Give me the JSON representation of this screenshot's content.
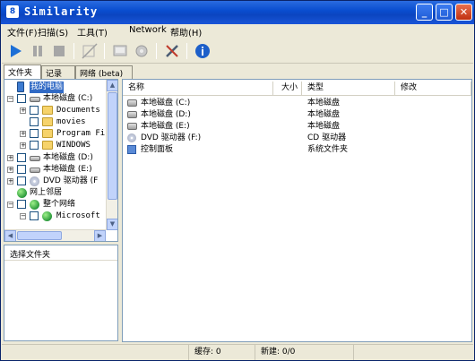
{
  "app": {
    "title": "Similarity",
    "icon_glyph": "8"
  },
  "window_controls": {
    "minimize": "_",
    "maximize": "□",
    "close": "✕"
  },
  "menu": [
    {
      "label": "文件(F)"
    },
    {
      "label": "扫描(S)"
    },
    {
      "label": "工具(T)"
    },
    {
      "label": "Network"
    },
    {
      "label": "帮助(H)"
    }
  ],
  "toolbar": {
    "play": "play-icon",
    "pause": "pause-icon",
    "stop": "stop-icon",
    "clear": "clear-icon",
    "export": "export-icon",
    "gear": "gear-icon",
    "tools": "wrench-icon",
    "info": "info-icon"
  },
  "tabs": [
    {
      "label": "文件夹"
    },
    {
      "label": "记录"
    },
    {
      "label": "网络 (beta)"
    }
  ],
  "tree": [
    {
      "label": "我的电脑",
      "icon": "computer-icon",
      "selected": true
    },
    {
      "label": "本地磁盘 (C:)",
      "icon": "drive-icon"
    },
    {
      "label": "Documents",
      "icon": "folder-icon"
    },
    {
      "label": "movies",
      "icon": "folder-icon"
    },
    {
      "label": "Program Fi",
      "icon": "folder-icon"
    },
    {
      "label": "WINDOWS",
      "icon": "folder-icon"
    },
    {
      "label": "本地磁盘 (D:)",
      "icon": "drive-icon"
    },
    {
      "label": "本地磁盘 (E:)",
      "icon": "drive-icon"
    },
    {
      "label": "DVD 驱动器 (F",
      "icon": "dvd-icon"
    },
    {
      "label": "网上邻居",
      "icon": "network-icon"
    },
    {
      "label": "整个网络",
      "icon": "globe-icon"
    },
    {
      "label": "Microsoft",
      "icon": "globe-icon"
    }
  ],
  "select_folder_label": "选择文件夹",
  "list": {
    "columns": {
      "name": "名称",
      "size": "大小",
      "type": "类型",
      "modified": "修改"
    },
    "rows": [
      {
        "name": "本地磁盘 (C:)",
        "size": "",
        "type": "本地磁盘",
        "modified": "",
        "icon": "drive-icon"
      },
      {
        "name": "本地磁盘 (D:)",
        "size": "",
        "type": "本地磁盘",
        "modified": "",
        "icon": "drive-icon"
      },
      {
        "name": "本地磁盘 (E:)",
        "size": "",
        "type": "本地磁盘",
        "modified": "",
        "icon": "drive-icon"
      },
      {
        "name": "DVD 驱动器 (F:)",
        "size": "",
        "type": "CD 驱动器",
        "modified": "",
        "icon": "dvd-icon"
      },
      {
        "name": "控制面板",
        "size": "",
        "type": "系统文件夹",
        "modified": "",
        "icon": "control-panel-icon"
      }
    ]
  },
  "status": {
    "cache": "缓存: 0",
    "new": "新建: 0/0"
  },
  "colors": {
    "title_bar": "#0a4ed0",
    "selection": "#316ac5",
    "window_bg": "#ece9d8"
  }
}
